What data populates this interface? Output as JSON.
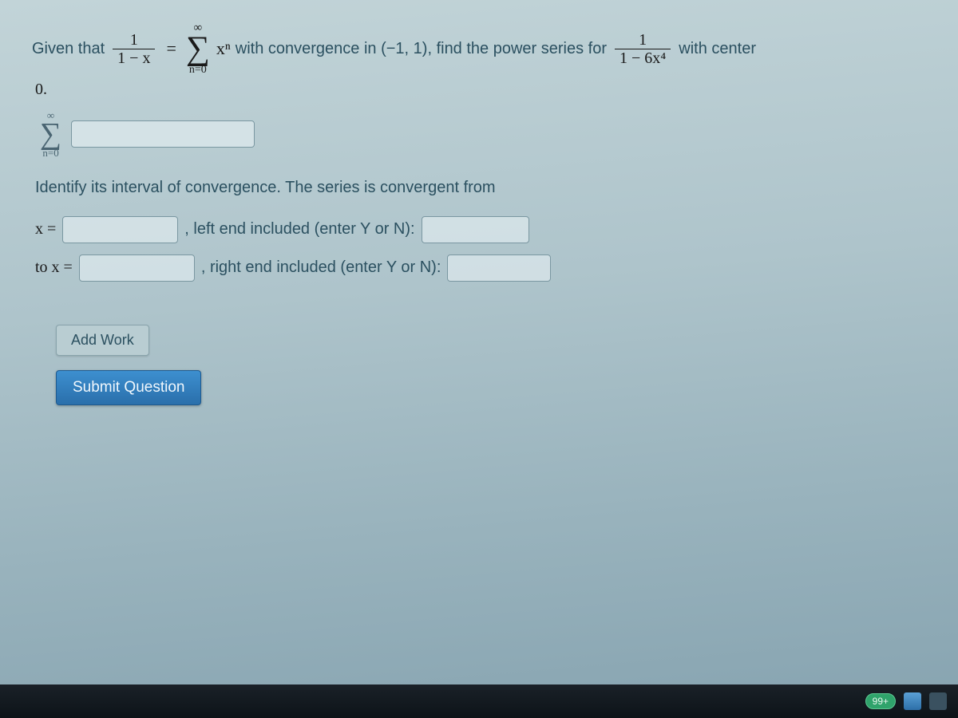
{
  "question": {
    "lead_in": "Given that",
    "frac1_num": "1",
    "frac1_den": "1 − x",
    "equals": "=",
    "sum_top": "∞",
    "sum_bottom": "n=0",
    "sum_term": "xⁿ",
    "convergence_text": "with convergence in (−1, 1), find the power series for",
    "frac2_num": "1",
    "frac2_den": "1 − 6x⁴",
    "trailing": "with center",
    "center_value": "0."
  },
  "answer_sum": {
    "top": "∞",
    "bottom": "n=0"
  },
  "interval_prompt": "Identify its interval of convergence. The series is convergent from",
  "row1": {
    "label": "x =",
    "left_text": ", left end included (enter Y or N):"
  },
  "row2": {
    "label": "to x =",
    "right_text": ", right end included (enter Y or N):"
  },
  "buttons": {
    "add_work": "Add Work",
    "submit": "Submit Question"
  },
  "taskbar": {
    "badge": "99+"
  }
}
